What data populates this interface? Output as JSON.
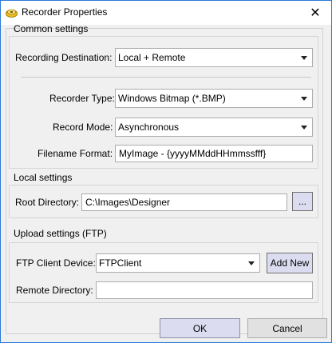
{
  "window": {
    "title": "Recorder Properties",
    "close_glyph": "✕",
    "icon": "recorder-app-icon"
  },
  "common": {
    "header": "Common settings",
    "destination_label": "Recording Destination:",
    "destination_value": "Local + Remote",
    "type_label": "Recorder Type:",
    "type_value": "Windows Bitmap (*.BMP)",
    "mode_label": "Record Mode:",
    "mode_value": "Asynchronous",
    "filename_label": "Filename Format:",
    "filename_value": "MyImage - {yyyyMMddHHmmssfff}"
  },
  "local": {
    "header": "Local settings",
    "root_label": "Root Directory:",
    "root_value": "C:\\Images\\Designer",
    "browse_label": "..."
  },
  "upload": {
    "header": "Upload settings (FTP)",
    "device_label": "FTP Client Device:",
    "device_value": "FTPClient",
    "add_new_label": "Add New",
    "remote_label": "Remote Directory:",
    "remote_value": ""
  },
  "footer": {
    "ok_label": "OK",
    "cancel_label": "Cancel"
  }
}
